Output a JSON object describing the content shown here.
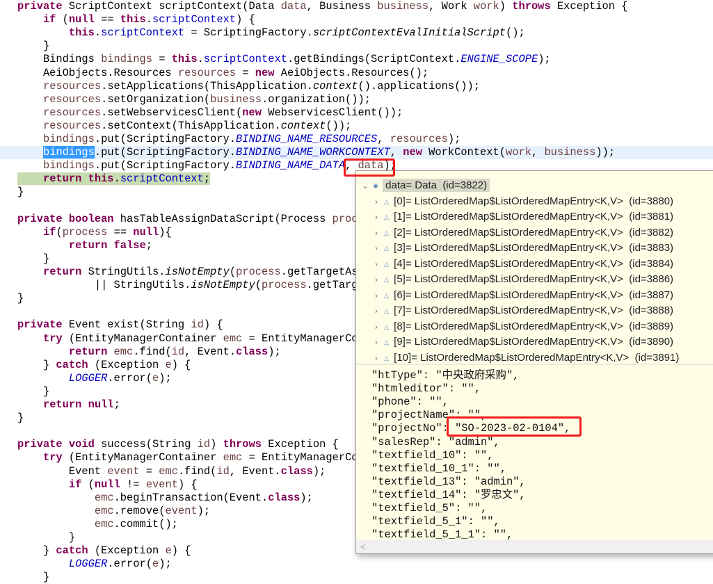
{
  "code": [
    [
      [
        "k",
        "private "
      ],
      [
        "p",
        "ScriptContext scriptContext(Data "
      ],
      [
        "v",
        "data"
      ],
      [
        "p",
        ", Business "
      ],
      [
        "v",
        "business"
      ],
      [
        "p",
        ", Work "
      ],
      [
        "v",
        "work"
      ],
      [
        "p",
        ") "
      ],
      [
        "k",
        "throws "
      ],
      [
        "p",
        "Exception {"
      ]
    ],
    [
      [
        "p",
        "    "
      ],
      [
        "k",
        "if "
      ],
      [
        "p",
        "("
      ],
      [
        "k",
        "null "
      ],
      [
        "p",
        "== "
      ],
      [
        "k",
        "this"
      ],
      [
        "p",
        "."
      ],
      [
        "f",
        "scriptContext"
      ],
      [
        "p",
        ") {"
      ]
    ],
    [
      [
        "p",
        "        "
      ],
      [
        "k",
        "this"
      ],
      [
        "p",
        "."
      ],
      [
        "f",
        "scriptContext"
      ],
      [
        "p",
        " = ScriptingFactory."
      ],
      [
        "m",
        "scriptContextEvalInitialScript"
      ],
      [
        "p",
        "();"
      ]
    ],
    [
      [
        "p",
        "    }"
      ]
    ],
    [
      [
        "p",
        "    Bindings "
      ],
      [
        "v",
        "bindings"
      ],
      [
        "p",
        " = "
      ],
      [
        "k",
        "this"
      ],
      [
        "p",
        "."
      ],
      [
        "f",
        "scriptContext"
      ],
      [
        "p",
        ".getBindings(ScriptContext."
      ],
      [
        "s",
        "ENGINE_SCOPE"
      ],
      [
        "p",
        ");"
      ]
    ],
    [
      [
        "p",
        "    AeiObjects.Resources "
      ],
      [
        "v",
        "resources"
      ],
      [
        "p",
        " = "
      ],
      [
        "k",
        "new "
      ],
      [
        "p",
        "AeiObjects.Resources();"
      ]
    ],
    [
      [
        "p",
        "    "
      ],
      [
        "v",
        "resources"
      ],
      [
        "p",
        ".setApplications(ThisApplication."
      ],
      [
        "m",
        "context"
      ],
      [
        "p",
        "().applications());"
      ]
    ],
    [
      [
        "p",
        "    "
      ],
      [
        "v",
        "resources"
      ],
      [
        "p",
        ".setOrganization("
      ],
      [
        "v",
        "business"
      ],
      [
        "p",
        ".organization());"
      ]
    ],
    [
      [
        "p",
        "    "
      ],
      [
        "v",
        "resources"
      ],
      [
        "p",
        ".setWebservicesClient("
      ],
      [
        "k",
        "new "
      ],
      [
        "p",
        "WebservicesClient());"
      ]
    ],
    [
      [
        "p",
        "    "
      ],
      [
        "v",
        "resources"
      ],
      [
        "p",
        ".setContext(ThisApplication."
      ],
      [
        "m",
        "context"
      ],
      [
        "p",
        "());"
      ]
    ],
    [
      [
        "p",
        "    "
      ],
      [
        "v",
        "bindings"
      ],
      [
        "p",
        ".put(ScriptingFactory."
      ],
      [
        "s",
        "BINDING_NAME_RESOURCES"
      ],
      [
        "p",
        ", "
      ],
      [
        "v",
        "resources"
      ],
      [
        "p",
        ");"
      ]
    ],
    [
      [
        "p",
        "    "
      ],
      [
        "sel",
        "bindings"
      ],
      [
        "p",
        ".put(ScriptingFactory."
      ],
      [
        "s",
        "BINDING_NAME_WORKCONTEXT"
      ],
      [
        "p",
        ", "
      ],
      [
        "k",
        "new "
      ],
      [
        "p",
        "WorkContext("
      ],
      [
        "v",
        "work"
      ],
      [
        "p",
        ", "
      ],
      [
        "v",
        "business"
      ],
      [
        "p",
        "));"
      ]
    ],
    [
      [
        "p",
        "    "
      ],
      [
        "v",
        "bindings"
      ],
      [
        "p",
        ".put(ScriptingFactory."
      ],
      [
        "s",
        "BINDING_NAME_DATA"
      ],
      [
        "p",
        ", "
      ],
      [
        "v",
        "data"
      ],
      [
        "p",
        ");"
      ]
    ],
    [
      [
        "p",
        "    "
      ],
      [
        "k",
        "return this"
      ],
      [
        "p",
        "."
      ],
      [
        "f",
        "scriptContext"
      ],
      [
        "p",
        ";"
      ]
    ],
    [
      [
        "p",
        "}"
      ]
    ],
    [],
    [
      [
        "k",
        "private boolean "
      ],
      [
        "p",
        "hasTableAssignDataScript(Process "
      ],
      [
        "v",
        "proc"
      ]
    ],
    [
      [
        "p",
        "    "
      ],
      [
        "k",
        "if"
      ],
      [
        "p",
        "("
      ],
      [
        "v",
        "process"
      ],
      [
        "p",
        " == "
      ],
      [
        "k",
        "null"
      ],
      [
        "p",
        "){"
      ]
    ],
    [
      [
        "p",
        "        "
      ],
      [
        "k",
        "return false"
      ],
      [
        "p",
        ";"
      ]
    ],
    [
      [
        "p",
        "    }"
      ]
    ],
    [
      [
        "p",
        "    "
      ],
      [
        "k",
        "return "
      ],
      [
        "p",
        "StringUtils."
      ],
      [
        "m",
        "isNotEmpty"
      ],
      [
        "p",
        "("
      ],
      [
        "v",
        "process"
      ],
      [
        "p",
        ".getTargetAs"
      ]
    ],
    [
      [
        "p",
        "            || StringUtils."
      ],
      [
        "m",
        "isNotEmpty"
      ],
      [
        "p",
        "("
      ],
      [
        "v",
        "process"
      ],
      [
        "p",
        ".getTarg"
      ]
    ],
    [
      [
        "p",
        "}"
      ]
    ],
    [],
    [
      [
        "k",
        "private "
      ],
      [
        "p",
        "Event exist(String "
      ],
      [
        "v",
        "id"
      ],
      [
        "p",
        ") {"
      ]
    ],
    [
      [
        "p",
        "    "
      ],
      [
        "k",
        "try "
      ],
      [
        "p",
        "(EntityManagerContainer "
      ],
      [
        "v",
        "emc"
      ],
      [
        "p",
        " = EntityManagerCo"
      ]
    ],
    [
      [
        "p",
        "        "
      ],
      [
        "k",
        "return "
      ],
      [
        "v",
        "emc"
      ],
      [
        "p",
        ".find("
      ],
      [
        "v",
        "id"
      ],
      [
        "p",
        ", Event."
      ],
      [
        "k",
        "class"
      ],
      [
        "p",
        ");"
      ]
    ],
    [
      [
        "p",
        "    } "
      ],
      [
        "k",
        "catch "
      ],
      [
        "p",
        "(Exception "
      ],
      [
        "v",
        "e"
      ],
      [
        "p",
        ") {"
      ]
    ],
    [
      [
        "p",
        "        "
      ],
      [
        "s",
        "LOGGER"
      ],
      [
        "p",
        ".error("
      ],
      [
        "v",
        "e"
      ],
      [
        "p",
        ");"
      ]
    ],
    [
      [
        "p",
        "    }"
      ]
    ],
    [
      [
        "p",
        "    "
      ],
      [
        "k",
        "return null"
      ],
      [
        "p",
        ";"
      ]
    ],
    [
      [
        "p",
        "}"
      ]
    ],
    [],
    [
      [
        "k",
        "private void "
      ],
      [
        "p",
        "success(String "
      ],
      [
        "v",
        "id"
      ],
      [
        "p",
        ") "
      ],
      [
        "k",
        "throws "
      ],
      [
        "p",
        "Exception {"
      ]
    ],
    [
      [
        "p",
        "    "
      ],
      [
        "k",
        "try "
      ],
      [
        "p",
        "(EntityManagerContainer "
      ],
      [
        "v",
        "emc"
      ],
      [
        "p",
        " = EntityManagerCo"
      ]
    ],
    [
      [
        "p",
        "        Event "
      ],
      [
        "v",
        "event"
      ],
      [
        "p",
        " = "
      ],
      [
        "v",
        "emc"
      ],
      [
        "p",
        ".find("
      ],
      [
        "v",
        "id"
      ],
      [
        "p",
        ", Event."
      ],
      [
        "k",
        "class"
      ],
      [
        "p",
        ");"
      ]
    ],
    [
      [
        "p",
        "        "
      ],
      [
        "k",
        "if "
      ],
      [
        "p",
        "("
      ],
      [
        "k",
        "null "
      ],
      [
        "p",
        "!= "
      ],
      [
        "v",
        "event"
      ],
      [
        "p",
        ") {"
      ]
    ],
    [
      [
        "p",
        "            "
      ],
      [
        "v",
        "emc"
      ],
      [
        "p",
        ".beginTransaction(Event."
      ],
      [
        "k",
        "class"
      ],
      [
        "p",
        ");"
      ]
    ],
    [
      [
        "p",
        "            "
      ],
      [
        "v",
        "emc"
      ],
      [
        "p",
        ".remove("
      ],
      [
        "v",
        "event"
      ],
      [
        "p",
        ");"
      ]
    ],
    [
      [
        "p",
        "            "
      ],
      [
        "v",
        "emc"
      ],
      [
        "p",
        ".commit();"
      ]
    ],
    [
      [
        "p",
        "        }"
      ]
    ],
    [
      [
        "p",
        "    } "
      ],
      [
        "k",
        "catch "
      ],
      [
        "p",
        "(Exception "
      ],
      [
        "v",
        "e"
      ],
      [
        "p",
        ") {"
      ]
    ],
    [
      [
        "p",
        "        "
      ],
      [
        "s",
        "LOGGER"
      ],
      [
        "p",
        ".error("
      ],
      [
        "v",
        "e"
      ],
      [
        "p",
        ");"
      ]
    ],
    [
      [
        "p",
        "    }"
      ]
    ]
  ],
  "popup": {
    "root": "data= Data  (id=3822)",
    "children": [
      "[0]= ListOrderedMap$ListOrderedMapEntry<K,V>  (id=3880)",
      "[1]= ListOrderedMap$ListOrderedMapEntry<K,V>  (id=3881)",
      "[2]= ListOrderedMap$ListOrderedMapEntry<K,V>  (id=3882)",
      "[3]= ListOrderedMap$ListOrderedMapEntry<K,V>  (id=3883)",
      "[4]= ListOrderedMap$ListOrderedMapEntry<K,V>  (id=3884)",
      "[5]= ListOrderedMap$ListOrderedMapEntry<K,V>  (id=3886)",
      "[6]= ListOrderedMap$ListOrderedMapEntry<K,V>  (id=3887)",
      "[7]= ListOrderedMap$ListOrderedMapEntry<K,V>  (id=3888)",
      "[8]= ListOrderedMap$ListOrderedMapEntry<K,V>  (id=3889)",
      "[9]= ListOrderedMap$ListOrderedMapEntry<K,V>  (id=3890)",
      "[10]= ListOrderedMap$ListOrderedMapEntry<K,V>  (id=3891)"
    ],
    "detail": [
      "\"htType\": \"中央政府采购\",",
      "\"htmleditor\": \"\",",
      "\"phone\": \"\",",
      "\"projectName\": \"\",",
      "\"projectNo\": \"SO-2023-02-0104\",",
      "\"salesRep\": \"admin\",",
      "\"textfield_10\": \"\",",
      "\"textfield_10_1\": \"\",",
      "\"textfield_13\": \"admin\",",
      "\"textfield_14\": \"罗忠文\",",
      "\"textfield_5\": \"\",",
      "\"textfield_5_1\": \"\",",
      "\"textfield_5_1_1\": \"\","
    ],
    "scroll_left": "<"
  }
}
